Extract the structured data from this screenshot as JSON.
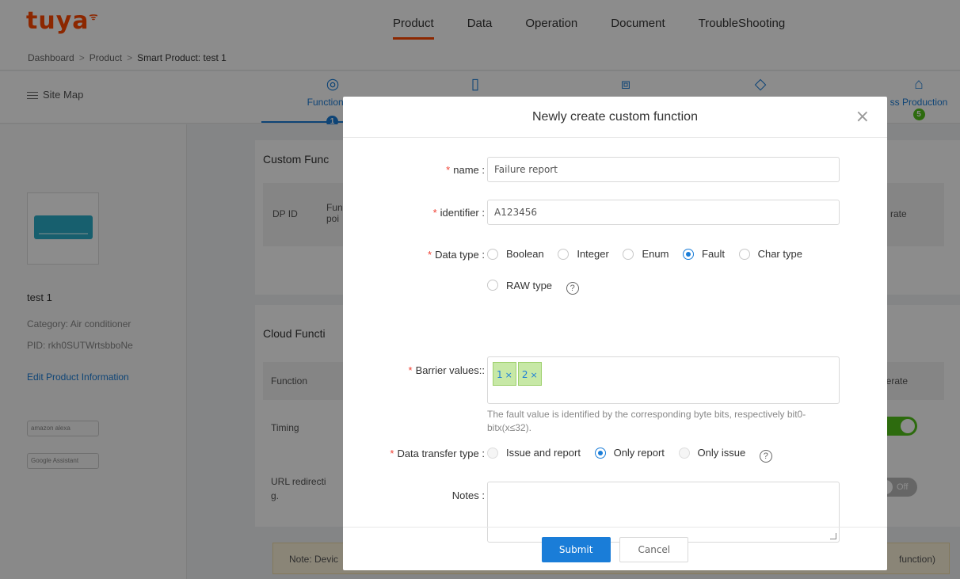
{
  "header": {
    "logo": "tuya",
    "nav": [
      "Product",
      "Data",
      "Operation",
      "Document",
      "TroubleShooting"
    ],
    "active_nav": "Product",
    "breadcrumb": [
      "Dashboard",
      "Product",
      "Smart Product: test 1"
    ]
  },
  "subbar": {
    "sitemap_label": "Site Map",
    "steps": [
      {
        "label": "Function De",
        "icon": "gear-icon",
        "number": "1"
      },
      {
        "label": "",
        "icon": "phone-icon"
      },
      {
        "label": "",
        "icon": "code-icon"
      },
      {
        "label": "",
        "icon": "diamond-icon"
      },
      {
        "label": "ss Production",
        "icon": "factory-icon",
        "number": "5"
      }
    ]
  },
  "product": {
    "name": "test 1",
    "category": "Category: Air conditioner",
    "pid": "PID: rkh0SUTWrtsbboNe",
    "edit_link": "Edit Product Information",
    "badges": [
      "amazon alexa",
      "Google Assistant"
    ]
  },
  "background": {
    "custom_functions_title": "Custom Func",
    "dp_id": "DP ID",
    "func_point": "Fun poi",
    "operate": "rate",
    "cloud_functions_title": "Cloud Functi",
    "col_function": "Function",
    "col_operate": "perate",
    "row_timing": "Timing",
    "toggle_on": "n",
    "row_url": "URL redirecti g.",
    "toggle_off": "Off",
    "note": "Note: Devic",
    "note_tail": "function)"
  },
  "modal": {
    "title": "Newly create custom function",
    "fields": {
      "name": {
        "label": "name",
        "value": "Failure report"
      },
      "identifier": {
        "label": "identifier",
        "value": "A123456"
      },
      "data_type": {
        "label": "Data type",
        "options": [
          "Boolean",
          "Integer",
          "Enum",
          "Fault",
          "Char type",
          "RAW type"
        ],
        "selected": "Fault"
      },
      "barrier_values": {
        "label": "Barrier values:",
        "tags": [
          "1",
          "2"
        ],
        "hint": "The fault value is identified by the corresponding byte bits, respectively bit0-bitx(x≤32)."
      },
      "data_transfer_type": {
        "label": "Data transfer type",
        "options": [
          "Issue and report",
          "Only report",
          "Only issue"
        ],
        "selected": "Only report"
      },
      "notes": {
        "label": "Notes",
        "value": ""
      }
    },
    "submit_label": "Submit",
    "cancel_label": "Cancel"
  },
  "colors": {
    "brand": "#ff4800",
    "primary": "#1a7dd8",
    "required": "#f04134",
    "tag_bg": "#c7e8a6",
    "toggle_on": "#52c41a"
  }
}
